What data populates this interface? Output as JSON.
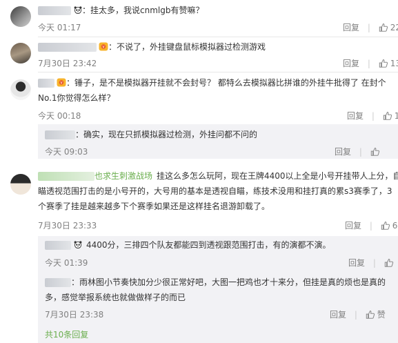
{
  "comments": [
    {
      "text": "：挂太多，我说cnmlgb有赞嘛？",
      "time": "今天 01:17",
      "reply": "回复",
      "likes": "22"
    },
    {
      "text": "：不说了，外挂键盘鼠标模拟器过检测游戏",
      "time": "7月30日 23:42",
      "reply": "回复",
      "likes": "13"
    },
    {
      "text_l1": "：锤子，是不是模拟器开挂就不会封号？ 都特么去模拟器比拼谁的外挂牛批得了 在封个",
      "text_l2": "No.1你觉得怎么样？",
      "time": "今天 00:18",
      "reply": "回复",
      "likes": "1"
    },
    {
      "text": "：确实，现在只抓模拟器过检测，外挂问都不问的",
      "time": "今天 09:03",
      "reply": "回复",
      "likes": ""
    },
    {
      "name": "也求生刺激战场",
      "text_l1": "挂这么多怎么玩阿，现在王牌4400以上全是小号开挂带人上分，自",
      "text_l2": "瞄透视范围打击的是小号开的，大号用的基本是透视自瞄，练技术没用和挂打真的累s3赛季了，3",
      "text_l3": "个赛季了挂是越来越多下个赛季如果还是这样挂名退游卸载了。",
      "time": "7月30日 23:33",
      "reply": "回复",
      "likes": "6"
    },
    {
      "text": "4400分，三排四个队友都能四到透视跟范围打击，有的演都不演。",
      "time": "今天 01:39",
      "reply": "回复",
      "likes": ""
    },
    {
      "text_l1": "：雨林图小节奏快加分少很正常好吧，大图一把鸡也才十来分，但挂是真的烦也是真的",
      "text_l2": "多，感觉举报系统也就做做样子的而已",
      "time": "7月30日 23:38",
      "reply": "回复",
      "likes": "赞"
    }
  ],
  "more_replies": "共10条回复",
  "icons": [
    "panda-emoji-icon",
    "vip-badge-icon",
    "thumb-up-icon"
  ]
}
